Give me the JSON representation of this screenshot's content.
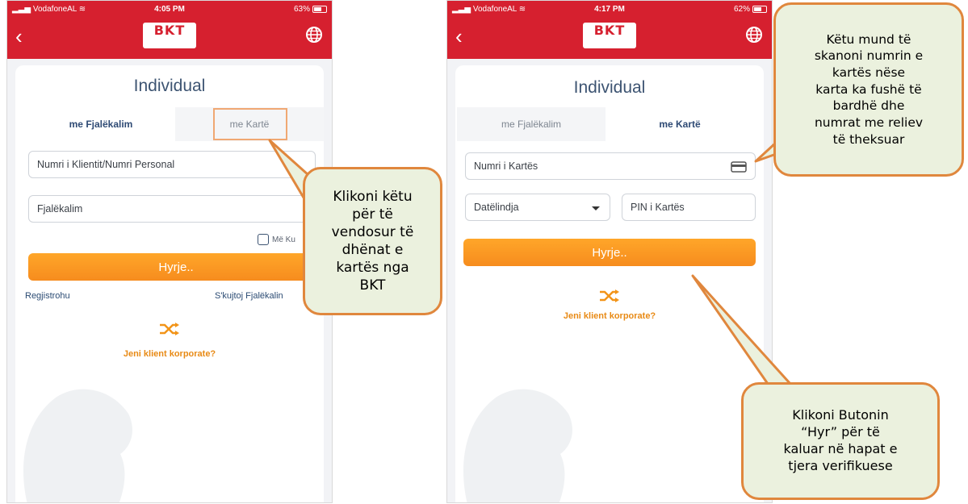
{
  "colors": {
    "brand_red": "#d6202f",
    "accent_orange": "#f7941d",
    "callout_fill": "#ebf1de",
    "callout_border": "#e0873d"
  },
  "left": {
    "status": {
      "carrier": "VodafoneAL",
      "time": "4:05 PM",
      "battery": "63%"
    },
    "logo_text": "BKT",
    "title": "Individual",
    "tabs": [
      {
        "label": "me Fjalëkalim",
        "active": true
      },
      {
        "label": "me Kartë",
        "active": false
      }
    ],
    "fields": {
      "client_placeholder": "Numri i Klientit/Numri Personal",
      "password_placeholder": "Fjalëkalim"
    },
    "remember_label": "Më Ku",
    "login_button": "Hyrje..",
    "register_link": "Regjistrohu",
    "forgot_link": "S'kujtoj Fjalëkalin",
    "corporate_link": "Jeni klient korporate?"
  },
  "right": {
    "status": {
      "carrier": "VodafoneAL",
      "time": "4:17 PM",
      "battery": "62%"
    },
    "logo_text": "BKT",
    "title": "Individual",
    "tabs": [
      {
        "label": "me Fjalëkalim",
        "active": false
      },
      {
        "label": "me Kartë",
        "active": true
      }
    ],
    "fields": {
      "card_number_placeholder": "Numri i Kartës",
      "birthdate_placeholder": "Datëlindja",
      "pin_placeholder": "PIN i Kartës"
    },
    "login_button": "Hyrje..",
    "corporate_link": "Jeni klient korporate?"
  },
  "callouts": {
    "card_tab": [
      "Klikoni këtu",
      "për të",
      "vendosur të",
      "dhënat e",
      "kartës nga",
      "BKT"
    ],
    "scan": [
      "Këtu mund të",
      "skanoni numrin e",
      "kartës nëse",
      "karta ka fushë të",
      "bardhë dhe",
      "numrat me reliev",
      "të theksuar"
    ],
    "login": [
      "Klikoni Butonin",
      "“Hyr” për të",
      "kaluar në hapat e",
      "tjera verifikuese"
    ]
  },
  "icons": {
    "back": "chevron-left-icon",
    "globe": "globe-icon",
    "shuffle": "shuffle-icon",
    "card": "credit-card-icon",
    "dropdown": "caret-down-icon",
    "wifi": "wifi-icon"
  }
}
